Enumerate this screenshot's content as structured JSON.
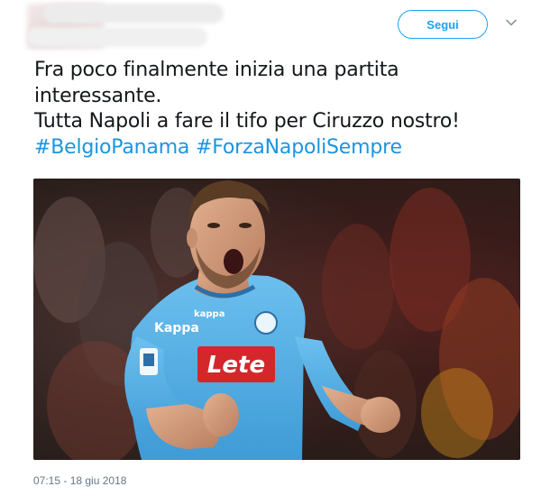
{
  "header": {
    "follow_label": "Segui"
  },
  "tweet": {
    "lines": [
      "Fra poco finalmente inizia una partita",
      "interessante.",
      "Tutta Napoli a fare il tifo per Ciruzzo nostro!"
    ],
    "hashtags": [
      "#BelgioPanama",
      "#ForzaNapoliSempre"
    ]
  },
  "media": {
    "jersey_sponsor": "Lete",
    "jersey_brand": "Kappa",
    "jersey_brand_small": "kappa"
  },
  "footer": {
    "timestamp": "07:15 - 18 giu 2018"
  },
  "colors": {
    "accent": "#1da1f2",
    "hashtag": "#1b95e0",
    "text": "#14171a",
    "muted": "#657786",
    "jersey": "#5bb3e8",
    "sponsor": "#d4272b"
  }
}
